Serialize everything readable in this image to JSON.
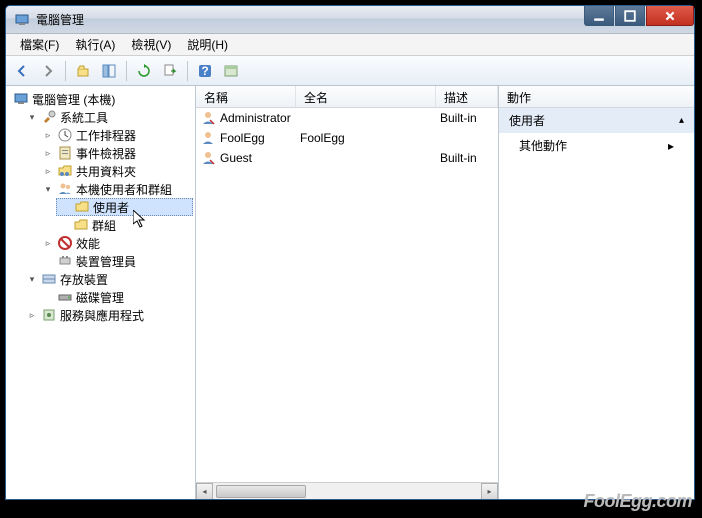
{
  "title": "電腦管理",
  "menu": {
    "file": "檔案(F)",
    "action": "執行(A)",
    "view": "檢視(V)",
    "help": "說明(H)"
  },
  "tree": {
    "root": "電腦管理 (本機)",
    "systools": "系統工具",
    "task": "工作排程器",
    "eventviewer": "事件檢視器",
    "sharedfolders": "共用資料夾",
    "localusers": "本機使用者和群組",
    "users": "使用者",
    "groups": "群組",
    "perf": "效能",
    "devmgr": "裝置管理員",
    "storage": "存放裝置",
    "diskmgr": "磁碟管理",
    "services": "服務與應用程式"
  },
  "list": {
    "col_name": "名稱",
    "col_fullname": "全名",
    "col_desc": "描述",
    "rows": [
      {
        "name": "Administrator",
        "full": "",
        "desc": "Built-in"
      },
      {
        "name": "FoolEgg",
        "full": "FoolEgg",
        "desc": ""
      },
      {
        "name": "Guest",
        "full": "",
        "desc": "Built-in"
      }
    ]
  },
  "actions": {
    "header": "動作",
    "section": "使用者",
    "more": "其他動作"
  },
  "watermark": "FoolEgg.com"
}
